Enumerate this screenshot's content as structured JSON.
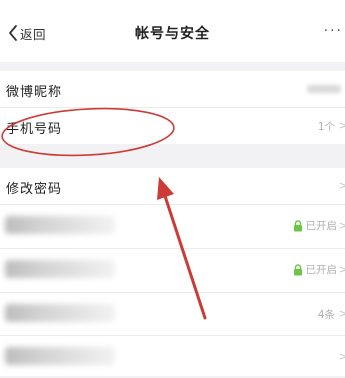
{
  "nav": {
    "back_label": "返回",
    "title": "帐号与安全",
    "more_label": "···"
  },
  "section1": {
    "nickname_label": "微博昵称",
    "phone_label": "手机号码",
    "phone_value": "1个",
    "chevron": ">"
  },
  "section2": {
    "password_label": "修改密码",
    "chevron": ">",
    "row2_status": "已开启",
    "row3_status": "已开启",
    "row4_value": "4条"
  },
  "colors": {
    "lock_green": "#6cc644",
    "annotation_red": "#cc3b36"
  }
}
